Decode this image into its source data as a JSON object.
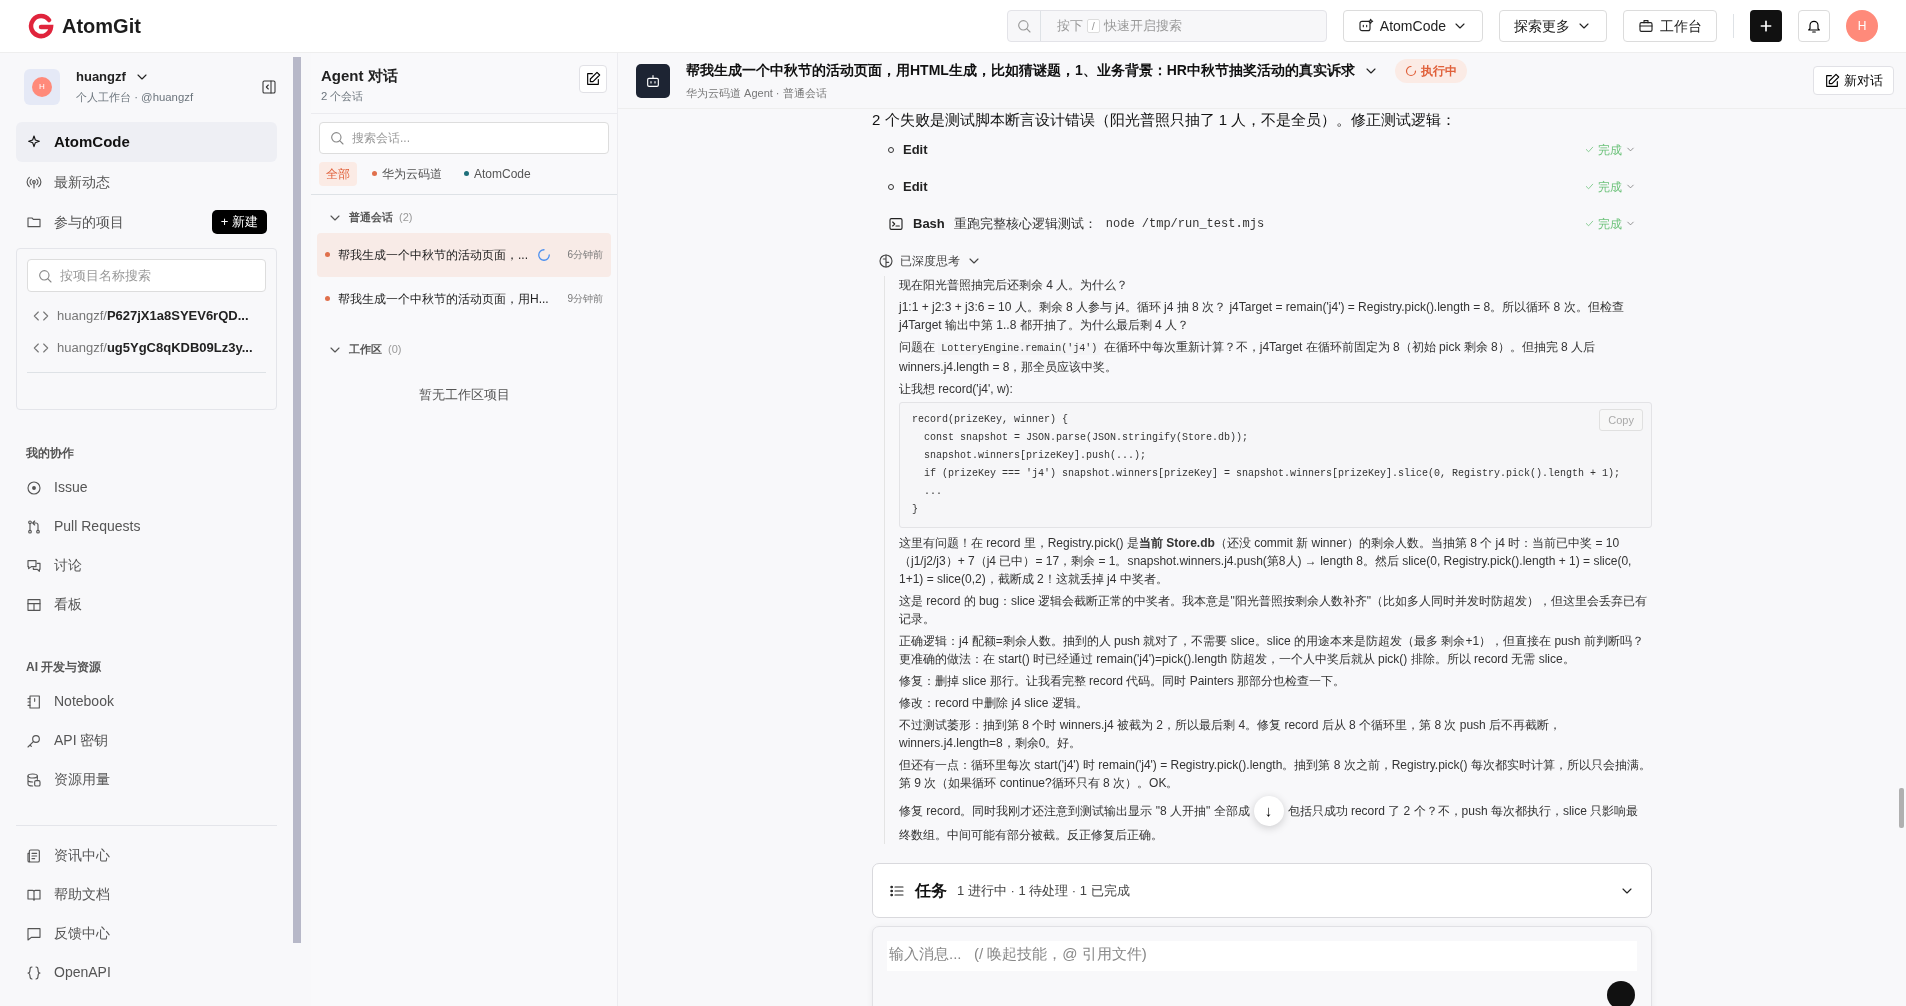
{
  "topbar": {
    "logo": "AtomGit",
    "search": {
      "prefix": "按下",
      "key": "/",
      "suffix": "快速开启搜索"
    },
    "product_button": "AtomCode",
    "explore_button": "探索更多",
    "workspace_button": "工作台",
    "avatar": "H"
  },
  "sidebar": {
    "user": {
      "name": "huangzf",
      "avatar": "H",
      "subtitle": "个人工作台 · @huangzf"
    },
    "primary": [
      {
        "label": "AtomCode",
        "selected": true
      },
      {
        "label": "最新动态",
        "selected": false
      },
      {
        "label": "参与的项目",
        "selected": false,
        "action": "+ 新建"
      }
    ],
    "project_search": {
      "placeholder": "按项目名称搜索"
    },
    "projects": [
      {
        "owner": "huangzf/",
        "name": "P627jX1a8SYEV6rQD..."
      },
      {
        "owner": "huangzf/",
        "name": "ug5YgC8qKDB09Lz3y..."
      }
    ],
    "groups": [
      {
        "heading": "我的协作",
        "items": [
          "Issue",
          "Pull Requests",
          "讨论",
          "看板"
        ]
      },
      {
        "heading": "AI 开发与资源",
        "items": [
          "Notebook",
          "API 密钥",
          "资源用量"
        ]
      },
      {
        "items": [
          "资讯中心",
          "帮助文档",
          "反馈中心",
          "OpenAPI"
        ]
      }
    ]
  },
  "agent_panel": {
    "title": "Agent 对话",
    "count": "2 个会话",
    "search": {
      "placeholder": "搜索会话..."
    },
    "filters": [
      {
        "label": "全部",
        "selected": true
      },
      {
        "label": "华为云码道",
        "selected": false,
        "color": "#e0704c"
      },
      {
        "label": "AtomCode",
        "selected": false,
        "color": "#1f6f7a"
      }
    ],
    "sections": [
      {
        "title": "普通会话",
        "count": "(2)",
        "expanded": true,
        "items": [
          {
            "title": "帮我生成一个中秋节的活动页面，...",
            "time": "6分钟前",
            "selected": true,
            "running": true,
            "color": "#e0704c"
          },
          {
            "title": "帮我生成一个中秋节的活动页面，用H...",
            "time": "9分钟前",
            "selected": false,
            "running": false,
            "color": "#e0704c"
          }
        ]
      },
      {
        "title": "工作区",
        "count": "(0)",
        "expanded": true,
        "empty": "暂无工作区项目"
      }
    ]
  },
  "chat": {
    "title": "帮我生成一个中秋节的活动页面，用HTML生成，比如猜谜题，1、业务背景：HR中秋节抽奖活动的真实诉求",
    "subtitle": "华为云码道 Agent · 普通会话",
    "status": "执行中",
    "new_button": "新对话",
    "intro": "2 个失败是测试脚本断言设计错误（阳光普照只抽了 1 人，不是全员）。修正测试逻辑：",
    "tools": [
      {
        "kind": "edit",
        "name": "Edit",
        "status": "完成"
      },
      {
        "kind": "edit",
        "name": "Edit",
        "status": "完成"
      },
      {
        "kind": "bash",
        "name": "Bash",
        "detail": "重跑完整核心逻辑测试：",
        "command": "node /tmp/run_test.mjs",
        "status": "完成"
      }
    ],
    "thinking": {
      "label": "已深度思考",
      "expanded": true,
      "blocks": [
        {
          "kind": "text",
          "text": "现在阳光普照抽完后还剩余 4 人。为什么？"
        },
        {
          "kind": "text",
          "text": "j1:1 + j2:3 + j3:6 = 10 人。剩余 8 人参与 j4。循环 j4 抽 8 次？ j4Target = remain('j4') = Registry.pick().length = 8。所以循环 8 次。但检查 j4Target 输出中第 1..8 都开抽了。为什么最后剩 4 人？"
        },
        {
          "kind": "mixed",
          "parts": [
            {
              "kind": "text",
              "text": "问题在 "
            },
            {
              "kind": "code",
              "text": "LotteryEngine.remain('j4')"
            },
            {
              "kind": "text",
              "text": " 在循环中每次重新计算？不，j4Target 在循环前固定为 8（初始 pick 剩余 8）。但抽完 8 人后 winners.j4.length = 8，那全员应该中奖。"
            }
          ]
        },
        {
          "kind": "text",
          "text": "让我想 record('j4', w):"
        },
        {
          "kind": "code",
          "copy": "Copy",
          "lines": [
            "record(prizeKey, winner) {",
            "  const snapshot = JSON.parse(JSON.stringify(Store.db));",
            "  snapshot.winners[prizeKey].push(...);",
            "  if (prizeKey === 'j4') snapshot.winners[prizeKey] = snapshot.winners[prizeKey].slice(0, Registry.pick().length + 1);",
            "  ...",
            "}"
          ]
        },
        {
          "kind": "text",
          "text": "这里有问题！在 record 里，Registry.pick() 是**当前 Store.db**（还没 commit 新 winner）的剩余人数。当抽第 8 个 j4 时：当前已中奖 = 10（j1/j2/j3）+ 7（j4 已中）= 17，剩余 = 1。snapshot.winners.j4.push(第8人) → length 8。然后 slice(0, Registry.pick().length + 1) = slice(0, 1+1) = slice(0,2)，截断成 2！这就丢掉 j4 中奖者。"
        },
        {
          "kind": "text",
          "text": "这是 record 的 bug：slice 逻辑会截断正常的中奖者。我本意是\"阳光普照按剩余人数补齐\"（比如多人同时并发时防超发），但这里会丢弃已有记录。"
        },
        {
          "kind": "text",
          "text": "正确逻辑：j4 配额=剩余人数。抽到的人 push 就对了，不需要 slice。slice 的用途本来是防超发（最多 剩余+1），但直接在 push 前判断吗？更准确的做法：在 start() 时已经通过 remain('j4')=pick().length 防超发，一个人中奖后就从 pick() 排除。所以 record 无需 slice。"
        },
        {
          "kind": "text",
          "text": "修复：删掉 slice 那行。让我看完整 record 代码。同时 Painters 那部分也检查一下。"
        },
        {
          "kind": "text",
          "text": "修改：record 中删除 j4 slice 逻辑。"
        },
        {
          "kind": "text",
          "text": "不过测试萎形：抽到第 8 个时 winners.j4 被截为 2，所以最后剩 4。修复 record 后从 8 个循环里，第 8 次 push 后不再截断，winners.j4.length=8，剩余0。好。"
        },
        {
          "kind": "text",
          "text": "但还有一点：循环里每次 start('j4') 时 remain('j4') = Registry.pick().length。抽到第 8 次之前，Registry.pick() 每次都实时计算，所以只会抽满。第 9 次（如果循环 continue?循环只有 8 次）。OK。"
        },
        {
          "kind": "covered",
          "before": "修复 record。同时我刚才还注意到测试输出显示 \"8 人开抽\" 全部成",
          "after": "包括只成功 record 了 2 个？不，push 每次都执行，slice 只影响最",
          "next_line": "终数组。中间可能有部分被截。反正修复后正确。"
        }
      ]
    },
    "scroll_button": "↓",
    "tasks": {
      "title": "任务",
      "summary": "1 进行中 · 1 待处理 · 1 已完成",
      "expanded": false
    },
    "composer": {
      "placeholder": "输入消息...   (/ 唤起技能，@ 引用文件)"
    }
  }
}
